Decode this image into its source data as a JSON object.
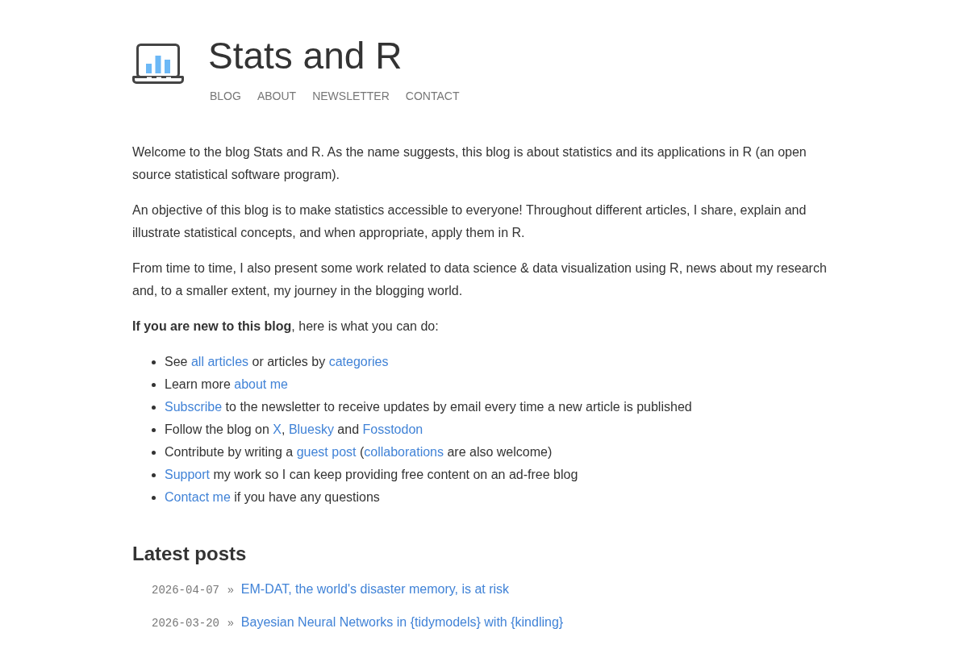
{
  "site": {
    "title": "Stats and R",
    "nav": [
      {
        "label": "BLOG"
      },
      {
        "label": "ABOUT"
      },
      {
        "label": "NEWSLETTER"
      },
      {
        "label": "CONTACT"
      }
    ]
  },
  "intro": {
    "paragraphs": [
      "Welcome to the blog Stats and R. As the name suggests, this blog is about statistics and its applications in R (an open source statistical software program).",
      "An objective of this blog is to make statistics accessible to everyone! Throughout different articles, I share, explain and illustrate statistical concepts, and when appropriate, apply them in R.",
      "From time to time, I also present some work related to data science & data visualization using R, news about my research and, to a smaller extent, my journey in the blogging world.",
      "**If you are new to this blog**, here is what you can do:"
    ],
    "todo": [
      {
        "parts": [
          {
            "kind": "text",
            "text": "See "
          },
          {
            "kind": "link",
            "text": "all articles"
          },
          {
            "kind": "text",
            "text": " or articles by "
          },
          {
            "kind": "link",
            "text": "categories"
          }
        ]
      },
      {
        "parts": [
          {
            "kind": "text",
            "text": "Learn more "
          },
          {
            "kind": "link",
            "text": "about me"
          }
        ]
      },
      {
        "parts": [
          {
            "kind": "link",
            "text": "Subscribe"
          },
          {
            "kind": "text",
            "text": " to the newsletter to receive updates by email every time a new article is published"
          }
        ]
      },
      {
        "parts": [
          {
            "kind": "text",
            "text": "Follow the blog on "
          },
          {
            "kind": "link",
            "text": "X"
          },
          {
            "kind": "text",
            "text": ", "
          },
          {
            "kind": "link",
            "text": "Bluesky"
          },
          {
            "kind": "text",
            "text": " and "
          },
          {
            "kind": "link",
            "text": "Fosstodon"
          }
        ]
      },
      {
        "parts": [
          {
            "kind": "text",
            "text": "Contribute by writing a "
          },
          {
            "kind": "link",
            "text": "guest post"
          },
          {
            "kind": "text",
            "text": " ("
          },
          {
            "kind": "link",
            "text": "collaborations"
          },
          {
            "kind": "text",
            "text": " are also welcome)"
          }
        ]
      },
      {
        "parts": [
          {
            "kind": "link",
            "text": "Support"
          },
          {
            "kind": "text",
            "text": " my work so I can keep providing free content on an ad-free blog"
          }
        ]
      },
      {
        "parts": [
          {
            "kind": "link",
            "text": "Contact me"
          },
          {
            "kind": "text",
            "text": " if you have any questions"
          }
        ]
      }
    ]
  },
  "latest_posts": {
    "heading": "Latest posts",
    "posts": [
      {
        "date": "2026-04-07",
        "separator": "»",
        "title": "EM-DAT, the world's disaster memory, is at risk"
      },
      {
        "date": "2026-03-20",
        "separator": "»",
        "title": "Bayesian Neural Networks in {tidymodels} with {kindling}"
      }
    ]
  }
}
